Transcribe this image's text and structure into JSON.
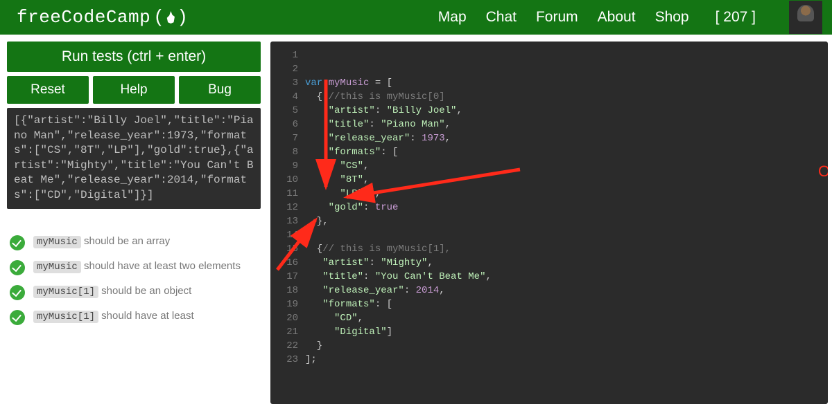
{
  "header": {
    "brand": "freeCodeCamp",
    "nav": [
      "Map",
      "Chat",
      "Forum",
      "About",
      "Shop"
    ],
    "points": "[ 207 ]"
  },
  "left": {
    "run": "Run tests (ctrl + enter)",
    "reset": "Reset",
    "help": "Help",
    "bug": "Bug",
    "output": "[{\"artist\":\"Billy Joel\",\"title\":\"Piano Man\",\"release_year\":1973,\"formats\":[\"CS\",\"8T\",\"LP\"],\"gold\":true},{\"artist\":\"Mighty\",\"title\":\"You Can't Beat Me\",\"release_year\":2014,\"formats\":[\"CD\",\"Digital\"]}]"
  },
  "tests": [
    {
      "code": "myMusic",
      "text": " should be an array"
    },
    {
      "code": "myMusic",
      "text": " should have at least two elements"
    },
    {
      "code": "myMusic[1]",
      "text": " should be an object"
    },
    {
      "code": "myMusic[1]",
      "text": " should have at least"
    }
  ],
  "annotation": "ONE FREAKIN COMMA!!!",
  "code": {
    "lines": 23,
    "l1": "",
    "l2_kw": "var",
    "l2_vn": "myMusic",
    "l2_rest": " = [",
    "l3_a": "  { ",
    "l3_cm": "//this is myMusic[0]",
    "l4_a": "    ",
    "l4_k": "\"artist\"",
    "l4_b": ": ",
    "l4_v": "\"Billy Joel\"",
    "l4_c": ",",
    "l5_a": "    ",
    "l5_k": "\"title\"",
    "l5_b": ": ",
    "l5_v": "\"Piano Man\"",
    "l5_c": ",",
    "l6_a": "    ",
    "l6_k": "\"release_year\"",
    "l6_b": ": ",
    "l6_v": "1973",
    "l6_c": ",",
    "l7_a": "    ",
    "l7_k": "\"formats\"",
    "l7_b": ": [",
    "l8_a": "      ",
    "l8_v": "\"CS\"",
    "l8_c": ",",
    "l9_a": "      ",
    "l9_v": "\"8T\"",
    "l9_c": ",",
    "l10_a": "      ",
    "l10_v": "\"LP\"",
    "l10_c": " ],",
    "l11_a": "    ",
    "l11_k": "\"gold\"",
    "l11_b": ": ",
    "l11_v": "true",
    "l12": "  },",
    "l13": "",
    "l14_a": "  {",
    "l14_cm": "// this is myMusic[1],",
    "l15_a": "   ",
    "l15_k": "\"artist\"",
    "l15_b": ": ",
    "l15_v": "\"Mighty\"",
    "l15_c": ",",
    "l16_a": "   ",
    "l16_k": "\"title\"",
    "l16_b": ": ",
    "l16_v": "\"You Can't Beat Me\"",
    "l16_c": ",",
    "l17_a": "   ",
    "l17_k": "\"release_year\"",
    "l17_b": ": ",
    "l17_v": "2014",
    "l17_c": ",",
    "l18_a": "   ",
    "l18_k": "\"formats\"",
    "l18_b": ": [",
    "l19_a": "     ",
    "l19_v": "\"CD\"",
    "l19_c": ",",
    "l20_a": "     ",
    "l20_v": "\"Digital\"",
    "l20_c": "]",
    "l21": "  }",
    "l22": "];",
    "l23": ""
  }
}
